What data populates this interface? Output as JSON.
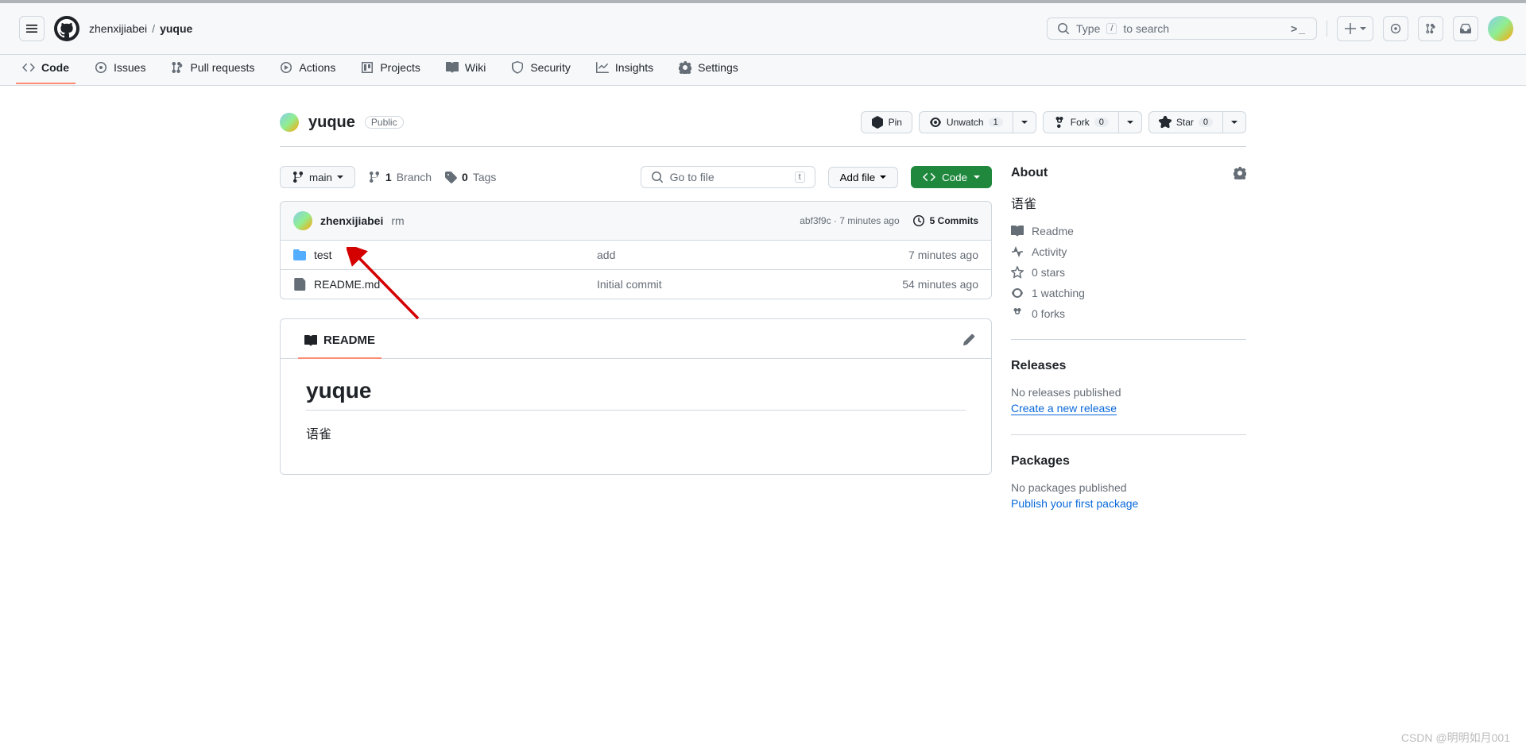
{
  "header": {
    "owner": "zhenxijiabei",
    "repo": "yuque",
    "search_placeholder": "Type",
    "search_suffix": "to search",
    "slash_key": "/"
  },
  "nav": {
    "code": "Code",
    "issues": "Issues",
    "pulls": "Pull requests",
    "actions": "Actions",
    "projects": "Projects",
    "wiki": "Wiki",
    "security": "Security",
    "insights": "Insights",
    "settings": "Settings"
  },
  "repo": {
    "name": "yuque",
    "visibility": "Public",
    "pin": "Pin",
    "unwatch": "Unwatch",
    "watch_count": "1",
    "fork": "Fork",
    "fork_count": "0",
    "star": "Star",
    "star_count": "0"
  },
  "branch": {
    "name": "main",
    "branches_count": "1",
    "branches_label": "Branch",
    "tags_count": "0",
    "tags_label": "Tags"
  },
  "filebar": {
    "search_placeholder": "Go to file",
    "tkey": "t",
    "addfile": "Add file",
    "code": "Code"
  },
  "commit": {
    "author": "zhenxijiabei",
    "message": "rm",
    "hash": "abf3f9c",
    "time": "7 minutes ago",
    "commits_count": "5 Commits"
  },
  "files": [
    {
      "type": "dir",
      "name": "test",
      "msg": "add",
      "time": "7 minutes ago"
    },
    {
      "type": "file",
      "name": "README.md",
      "msg": "Initial commit",
      "time": "54 minutes ago"
    }
  ],
  "readme": {
    "tab": "README",
    "title": "yuque",
    "body": "语雀"
  },
  "about": {
    "heading": "About",
    "description": "语雀",
    "readme": "Readme",
    "activity": "Activity",
    "stars": "0 stars",
    "watching": "1 watching",
    "forks": "0 forks"
  },
  "releases": {
    "heading": "Releases",
    "none": "No releases published",
    "create": "Create a new release"
  },
  "packages": {
    "heading": "Packages",
    "none": "No packages published",
    "publish": "Publish your first package"
  },
  "watermark": "CSDN @明明如月001"
}
